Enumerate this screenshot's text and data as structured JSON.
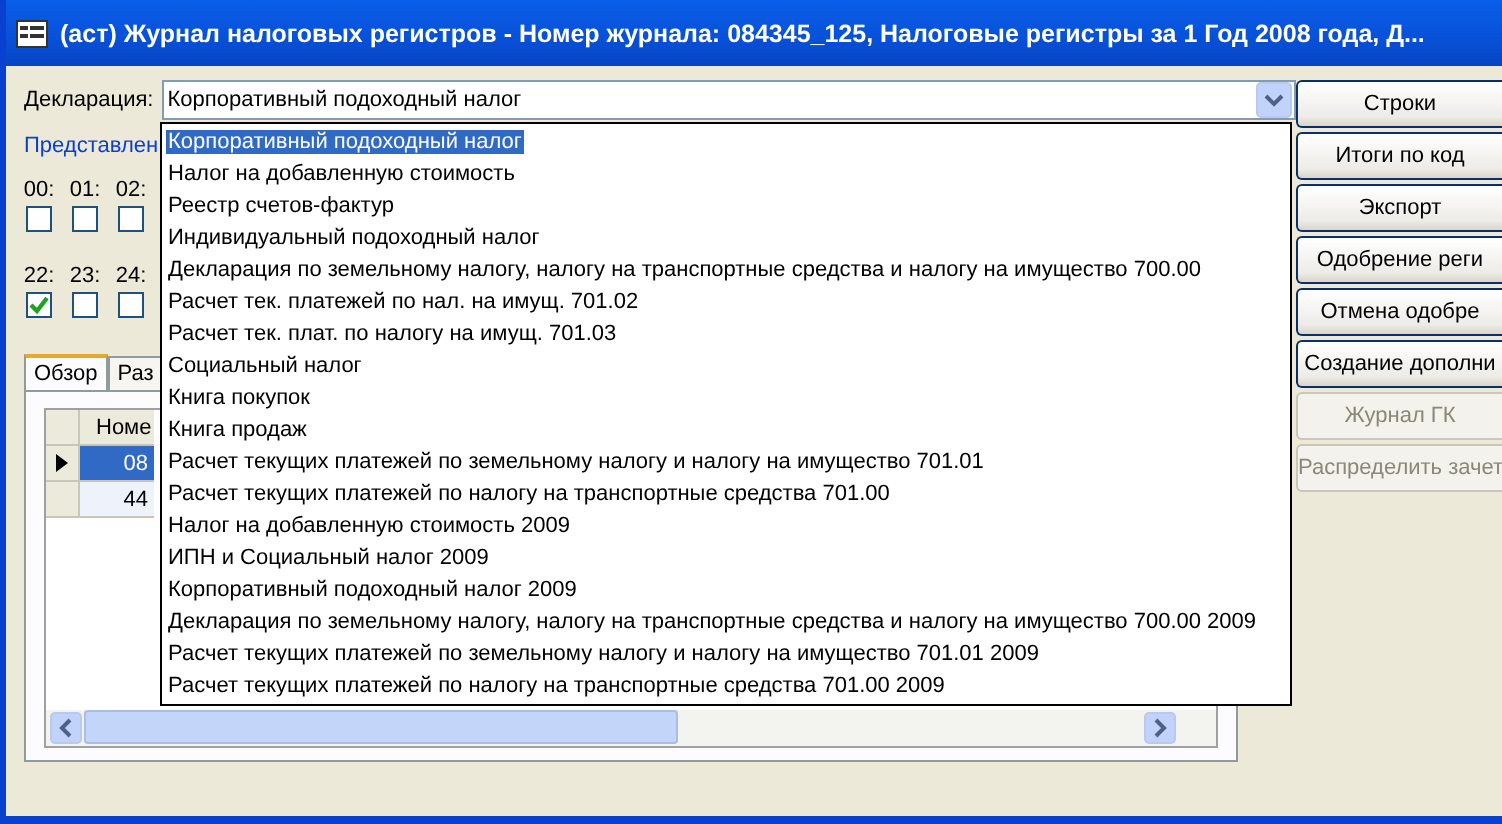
{
  "window": {
    "title": "(аст) Журнал налоговых регистров - Номер журнала: 084345_125, Налоговые регистры за 1 Год 2008 года, Д..."
  },
  "declaration": {
    "label": "Декларация:",
    "value": "Корпоративный подоходный налог"
  },
  "link": "Представлен",
  "checkbox_rows": [
    [
      {
        "label": "00:",
        "checked": false
      },
      {
        "label": "01:",
        "checked": false
      },
      {
        "label": "02:",
        "checked": false
      }
    ],
    [
      {
        "label": "22:",
        "checked": true
      },
      {
        "label": "23:",
        "checked": false
      },
      {
        "label": "24:",
        "checked": false
      }
    ]
  ],
  "tabs": [
    {
      "label": "Обзор",
      "selected": true
    },
    {
      "label": "Раз",
      "selected": false
    }
  ],
  "grid": {
    "columns": [
      "Номе"
    ],
    "rows": [
      {
        "cells": [
          "08"
        ],
        "selected": true
      },
      {
        "cells": [
          "44"
        ],
        "selected": false
      }
    ]
  },
  "buttons": [
    {
      "label": "Строки",
      "disabled": false
    },
    {
      "label": "Итоги по код",
      "disabled": false
    },
    {
      "label": "Экспорт",
      "disabled": false
    },
    {
      "label": "Одобрение реги",
      "disabled": false
    },
    {
      "label": "Отмена одобре",
      "disabled": false
    },
    {
      "label": "Создание дополни",
      "disabled": false
    },
    {
      "label": "Журнал ГК",
      "disabled": true
    },
    {
      "label": "Распределить зачет",
      "disabled": true
    }
  ],
  "dropdown": [
    {
      "label": "Корпоративный подоходный налог",
      "selected": true
    },
    {
      "label": "Налог на добавленную стоимость",
      "selected": false
    },
    {
      "label": "Реестр счетов-фактур",
      "selected": false
    },
    {
      "label": "Индивидуальный подоходный налог",
      "selected": false
    },
    {
      "label": "Декларация по земельному налогу, налогу на транспортные средства и налогу на имущество 700.00",
      "selected": false
    },
    {
      "label": "Расчет тек. платежей по нал. на имущ. 701.02",
      "selected": false
    },
    {
      "label": "Расчет тек. плат. по налогу на имущ. 701.03",
      "selected": false
    },
    {
      "label": "Социальный налог",
      "selected": false
    },
    {
      "label": "Книга покупок",
      "selected": false
    },
    {
      "label": "Книга продаж",
      "selected": false
    },
    {
      "label": "Расчет текущих платежей по земельному налогу и налогу на имущество 701.01",
      "selected": false
    },
    {
      "label": "Расчет текущих платежей по налогу на транспортные средства 701.00",
      "selected": false
    },
    {
      "label": "Налог на добавленную стоимость 2009",
      "selected": false
    },
    {
      "label": "ИПН и Социальный налог 2009",
      "selected": false
    },
    {
      "label": "Корпоративный подоходный налог 2009",
      "selected": false
    },
    {
      "label": "Декларация по земельному налогу, налогу на транспортные средства и налогу на имущество 700.00 2009",
      "selected": false
    },
    {
      "label": "Расчет текущих платежей по земельному налогу и налогу на имущество 701.01 2009",
      "selected": false
    },
    {
      "label": "Расчет текущих платежей по налогу на транспортные средства 701.00 2009",
      "selected": false
    }
  ]
}
